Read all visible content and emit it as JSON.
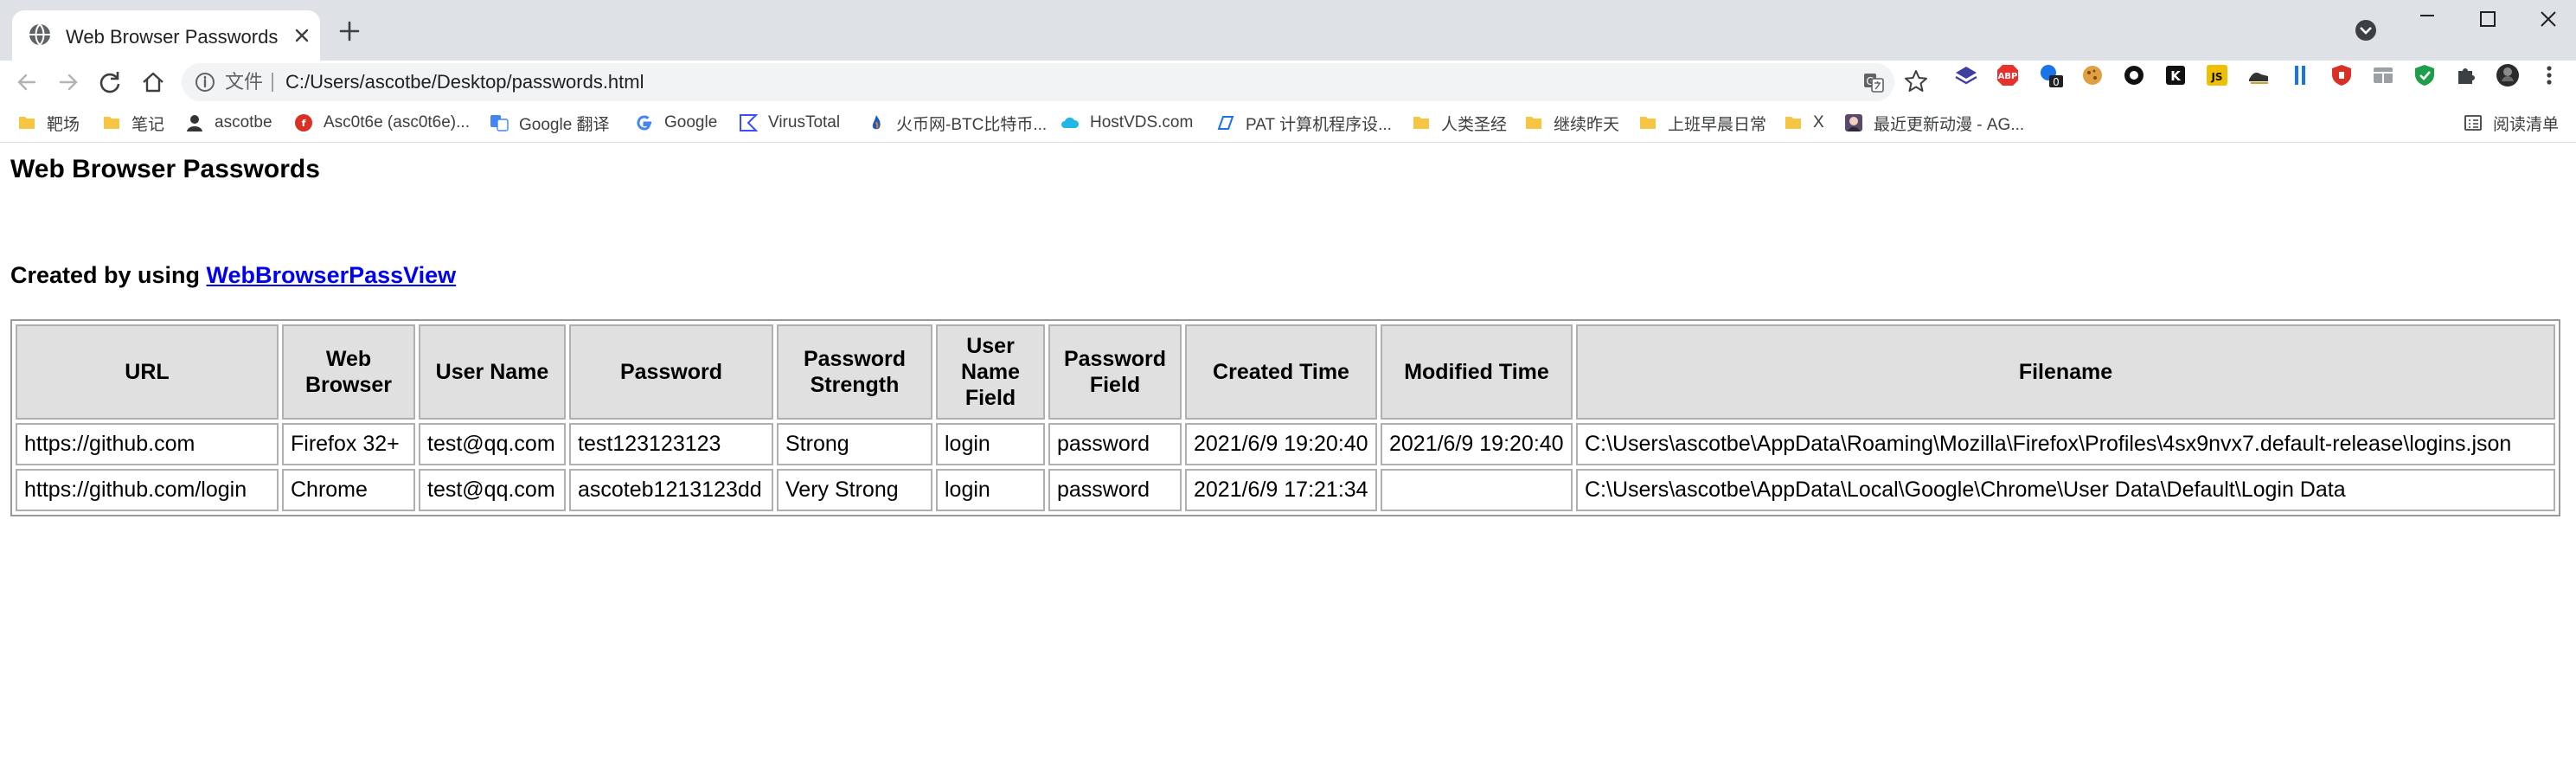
{
  "browser": {
    "tab_title": "Web Browser Passwords",
    "omnibox": {
      "scheme_label": "文件",
      "url": "C:/Users/ascotbe/Desktop/passwords.html"
    },
    "extension_icons": [
      "layers-icon",
      "adblock-plus-icon",
      "badge-extension-icon",
      "cookie-icon",
      "circle-extension-icon",
      "k-extension-icon",
      "js-extension-icon",
      "shoe-extension-icon",
      "bars-extension-icon",
      "shield-red-icon",
      "table-extension-icon",
      "shield-green-icon",
      "puzzle-icon",
      "profile-avatar",
      "menu-icon"
    ],
    "extension_badge": "0",
    "bookmarks": [
      {
        "label": "靶场",
        "icon": "folder-icon"
      },
      {
        "label": "笔记",
        "icon": "folder-icon"
      },
      {
        "label": "ascotbe",
        "icon": "person-icon"
      },
      {
        "label": "Asc0t6e (asc0t6e)...",
        "icon": "site-icon"
      },
      {
        "label": "Google 翻译",
        "icon": "translate-icon"
      },
      {
        "label": "Google",
        "icon": "google-icon"
      },
      {
        "label": "VirusTotal",
        "icon": "virustotal-icon"
      },
      {
        "label": "火币网-BTC比特币...",
        "icon": "flame-icon"
      },
      {
        "label": "HostVDS.com",
        "icon": "cloud-icon"
      },
      {
        "label": "PAT 计算机程序设...",
        "icon": "pat-icon"
      },
      {
        "label": "人类圣经",
        "icon": "folder-icon"
      },
      {
        "label": "继续昨天",
        "icon": "folder-icon"
      },
      {
        "label": "上班早晨日常",
        "icon": "folder-icon"
      },
      {
        "label": "X",
        "icon": "folder-icon"
      },
      {
        "label": "最近更新动漫 - AG...",
        "icon": "anime-site-icon"
      }
    ],
    "reading_list_label": "阅读清单",
    "colors": {
      "tab_strip": "#dee1e6",
      "omnibox": "#f1f3f4",
      "table_header": "#e0e0e0",
      "link": "#0000ee"
    }
  },
  "page": {
    "title": "Web Browser Passwords",
    "created_by_prefix": "Created by using ",
    "created_by_link": "WebBrowserPassView",
    "columns": [
      "URL",
      "Web Browser",
      "User Name",
      "Password",
      "Password Strength",
      "User Name Field",
      "Password Field",
      "Created Time",
      "Modified Time",
      "Filename"
    ],
    "rows": [
      [
        "https://github.com",
        "Firefox 32+",
        "test@qq.com",
        "test123123123",
        "Strong",
        "login",
        "password",
        "2021/6/9 19:20:40",
        "2021/6/9 19:20:40",
        "C:\\Users\\ascotbe\\AppData\\Roaming\\Mozilla\\Firefox\\Profiles\\4sx9nvx7.default-release\\logins.json"
      ],
      [
        "https://github.com/login",
        "Chrome",
        "test@qq.com",
        "ascoteb1213123dd",
        "Very Strong",
        "login",
        "password",
        "2021/6/9 17:21:34",
        "",
        "C:\\Users\\ascotbe\\AppData\\Local\\Google\\Chrome\\User Data\\Default\\Login Data"
      ]
    ]
  }
}
